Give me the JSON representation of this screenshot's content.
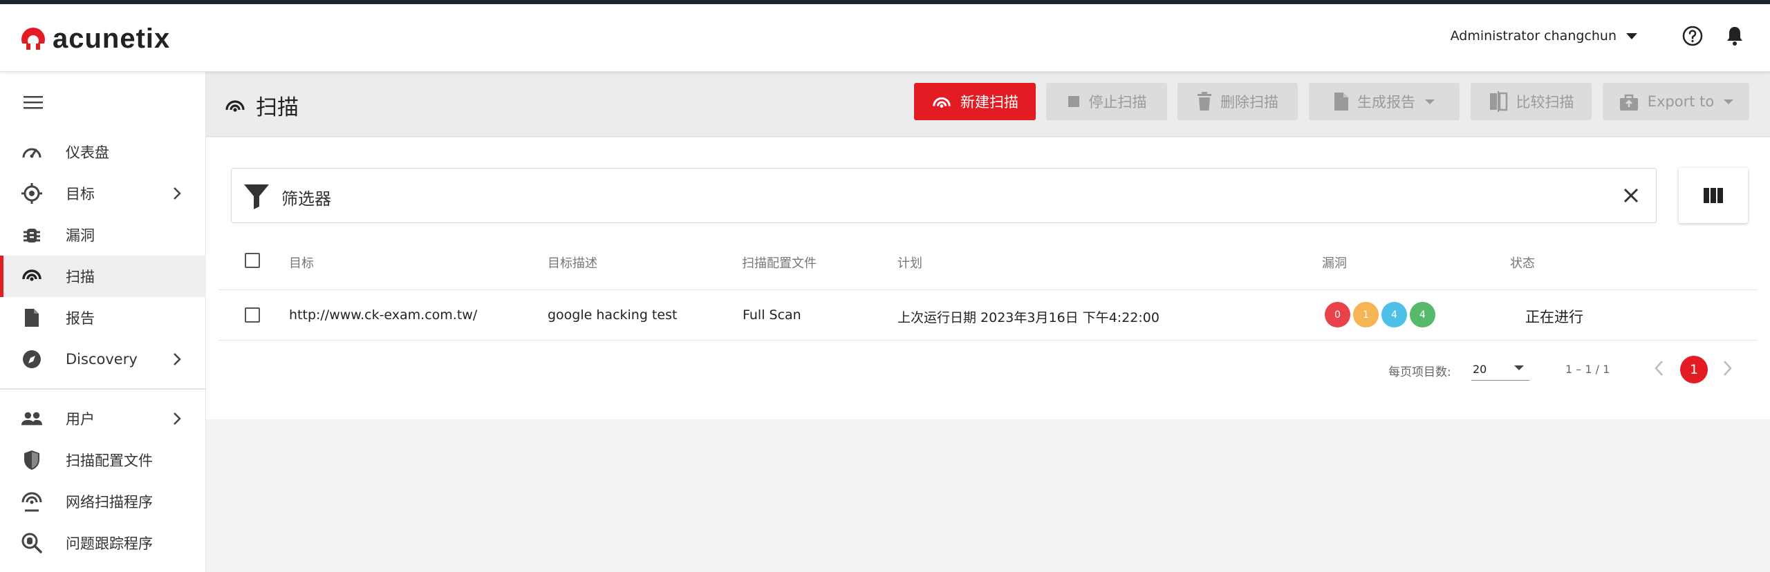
{
  "app": {
    "name": "acunetix"
  },
  "colors": {
    "brand": "#e31b23",
    "badge_critical": "#e8424a",
    "badge_high": "#f6b554",
    "badge_medium": "#4fc1e8",
    "badge_low": "#56b96b"
  },
  "header": {
    "user_name": "Administrator changchun",
    "icons": [
      "help-icon",
      "bell-icon"
    ]
  },
  "sidebar": {
    "items": [
      {
        "label": "仪表盘",
        "icon": "dashboard-icon"
      },
      {
        "label": "目标",
        "icon": "target-icon",
        "has_submenu": true
      },
      {
        "label": "漏洞",
        "icon": "bug-icon"
      },
      {
        "label": "扫描",
        "icon": "scan-icon",
        "active": true
      },
      {
        "label": "报告",
        "icon": "report-icon"
      },
      {
        "label": "Discovery",
        "icon": "compass-icon",
        "has_submenu": true
      },
      {
        "label": "用户",
        "icon": "users-icon",
        "has_submenu": true
      },
      {
        "label": "扫描配置文件",
        "icon": "shield-icon"
      },
      {
        "label": "网络扫描程序",
        "icon": "network-scanner-icon"
      },
      {
        "label": "问题跟踪程序",
        "icon": "issue-tracker-icon"
      }
    ]
  },
  "toolbar": {
    "title": "扫描",
    "new_scan": "新建扫描",
    "stop_scan": "停止扫描",
    "delete_scan": "删除扫描",
    "generate_report": "生成报告",
    "compare_scans": "比较扫描",
    "export_to": "Export to"
  },
  "filter": {
    "label": "筛选器"
  },
  "table": {
    "columns": [
      "目标",
      "目标描述",
      "扫描配置文件",
      "计划",
      "漏洞",
      "状态"
    ],
    "rows": [
      {
        "target": "http://www.ck-exam.com.tw/",
        "description": "google hacking test",
        "profile": "Full Scan",
        "schedule": "上次运行日期 2023年3月16日 下午4:22:00",
        "vulns": {
          "critical": "0",
          "high": "1",
          "medium": "4",
          "low": "4"
        },
        "status": "正在进行"
      }
    ]
  },
  "pagination": {
    "per_page_label": "每页项目数:",
    "per_page_value": "20",
    "range": "1 – 1 / 1",
    "current_page": "1"
  }
}
